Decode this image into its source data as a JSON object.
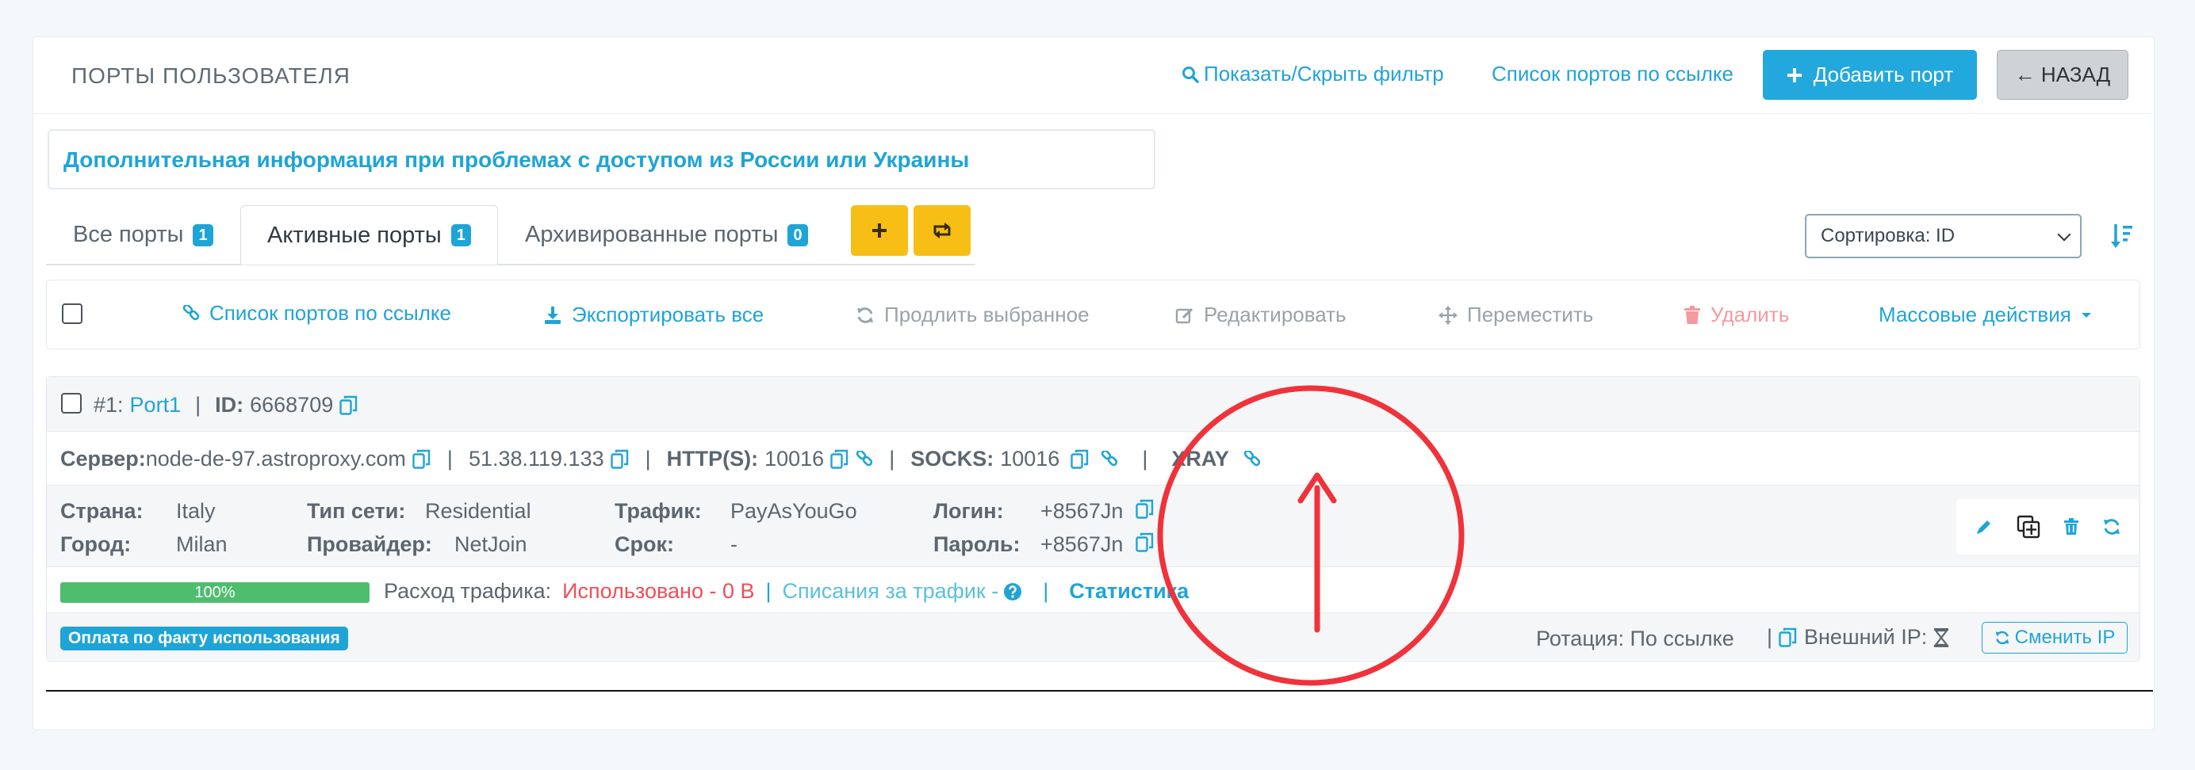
{
  "header": {
    "title": "ПОРТЫ ПОЛЬЗОВАТЕЛЯ",
    "filter_toggle": "Показать/Скрыть фильтр",
    "ports_by_link": "Список портов по ссылке",
    "add_port": "Добавить порт",
    "back": "← НАЗАД"
  },
  "info_banner": "Дополнительная информация при проблемах с доступом из России или Украины",
  "tabs": [
    {
      "label": "Все порты",
      "count": "1"
    },
    {
      "label": "Активные порты",
      "count": "1"
    },
    {
      "label": "Архивированные порты",
      "count": "0"
    }
  ],
  "sort": {
    "selected": "Сортировка: ID"
  },
  "toolbar": {
    "ports_by_link": "Список портов по ссылке",
    "export_all": "Экспортировать все",
    "extend_selected": "Продлить выбранное",
    "edit": "Редактировать",
    "move": "Переместить",
    "delete": "Удалить",
    "bulk_actions": "Массовые действия"
  },
  "port": {
    "number": "#1:",
    "name": "Port1",
    "id_label": "ID:",
    "id_value": "6668709",
    "server_label": "Сервер:",
    "server_value": "node-de-97.astroproxy.com",
    "ip": "51.38.119.133",
    "http_label": "HTTP(S):",
    "http_port": "10016",
    "socks_label": "SOCKS:",
    "socks_port": "10016",
    "xray_label": "XRAY",
    "country_label": "Страна:",
    "country_value": "Italy",
    "city_label": "Город:",
    "city_value": "Milan",
    "net_type_label": "Тип сети:",
    "net_type_value": "Residential",
    "provider_label": "Провайдер:",
    "provider_value": "NetJoin",
    "traffic_label": "Трафик:",
    "traffic_value": "PayAsYouGo",
    "term_label": "Срок:",
    "term_value": "-",
    "login_label": "Логин:",
    "login_value": "+8567Jn",
    "password_label": "Пароль:",
    "password_value": "+8567Jn",
    "progress_text": "100%",
    "progress_fraction": 1.0,
    "traffic_usage_label": "Расход трафика:",
    "traffic_used": "Использовано - 0 B",
    "traffic_charges": "Списания за трафик -",
    "statistics": "Статистика",
    "billing_badge": "Оплата по факту использования",
    "rotation": "Ротация: По ссылке",
    "external_ip_label": "Внешний IP:",
    "change_ip": "Сменить IP"
  },
  "colors": {
    "accent": "#1fa4d6",
    "warning": "#f7bf15",
    "danger": "#ee4f56",
    "success": "#4fbd6e",
    "annotation": "#f0323a"
  }
}
